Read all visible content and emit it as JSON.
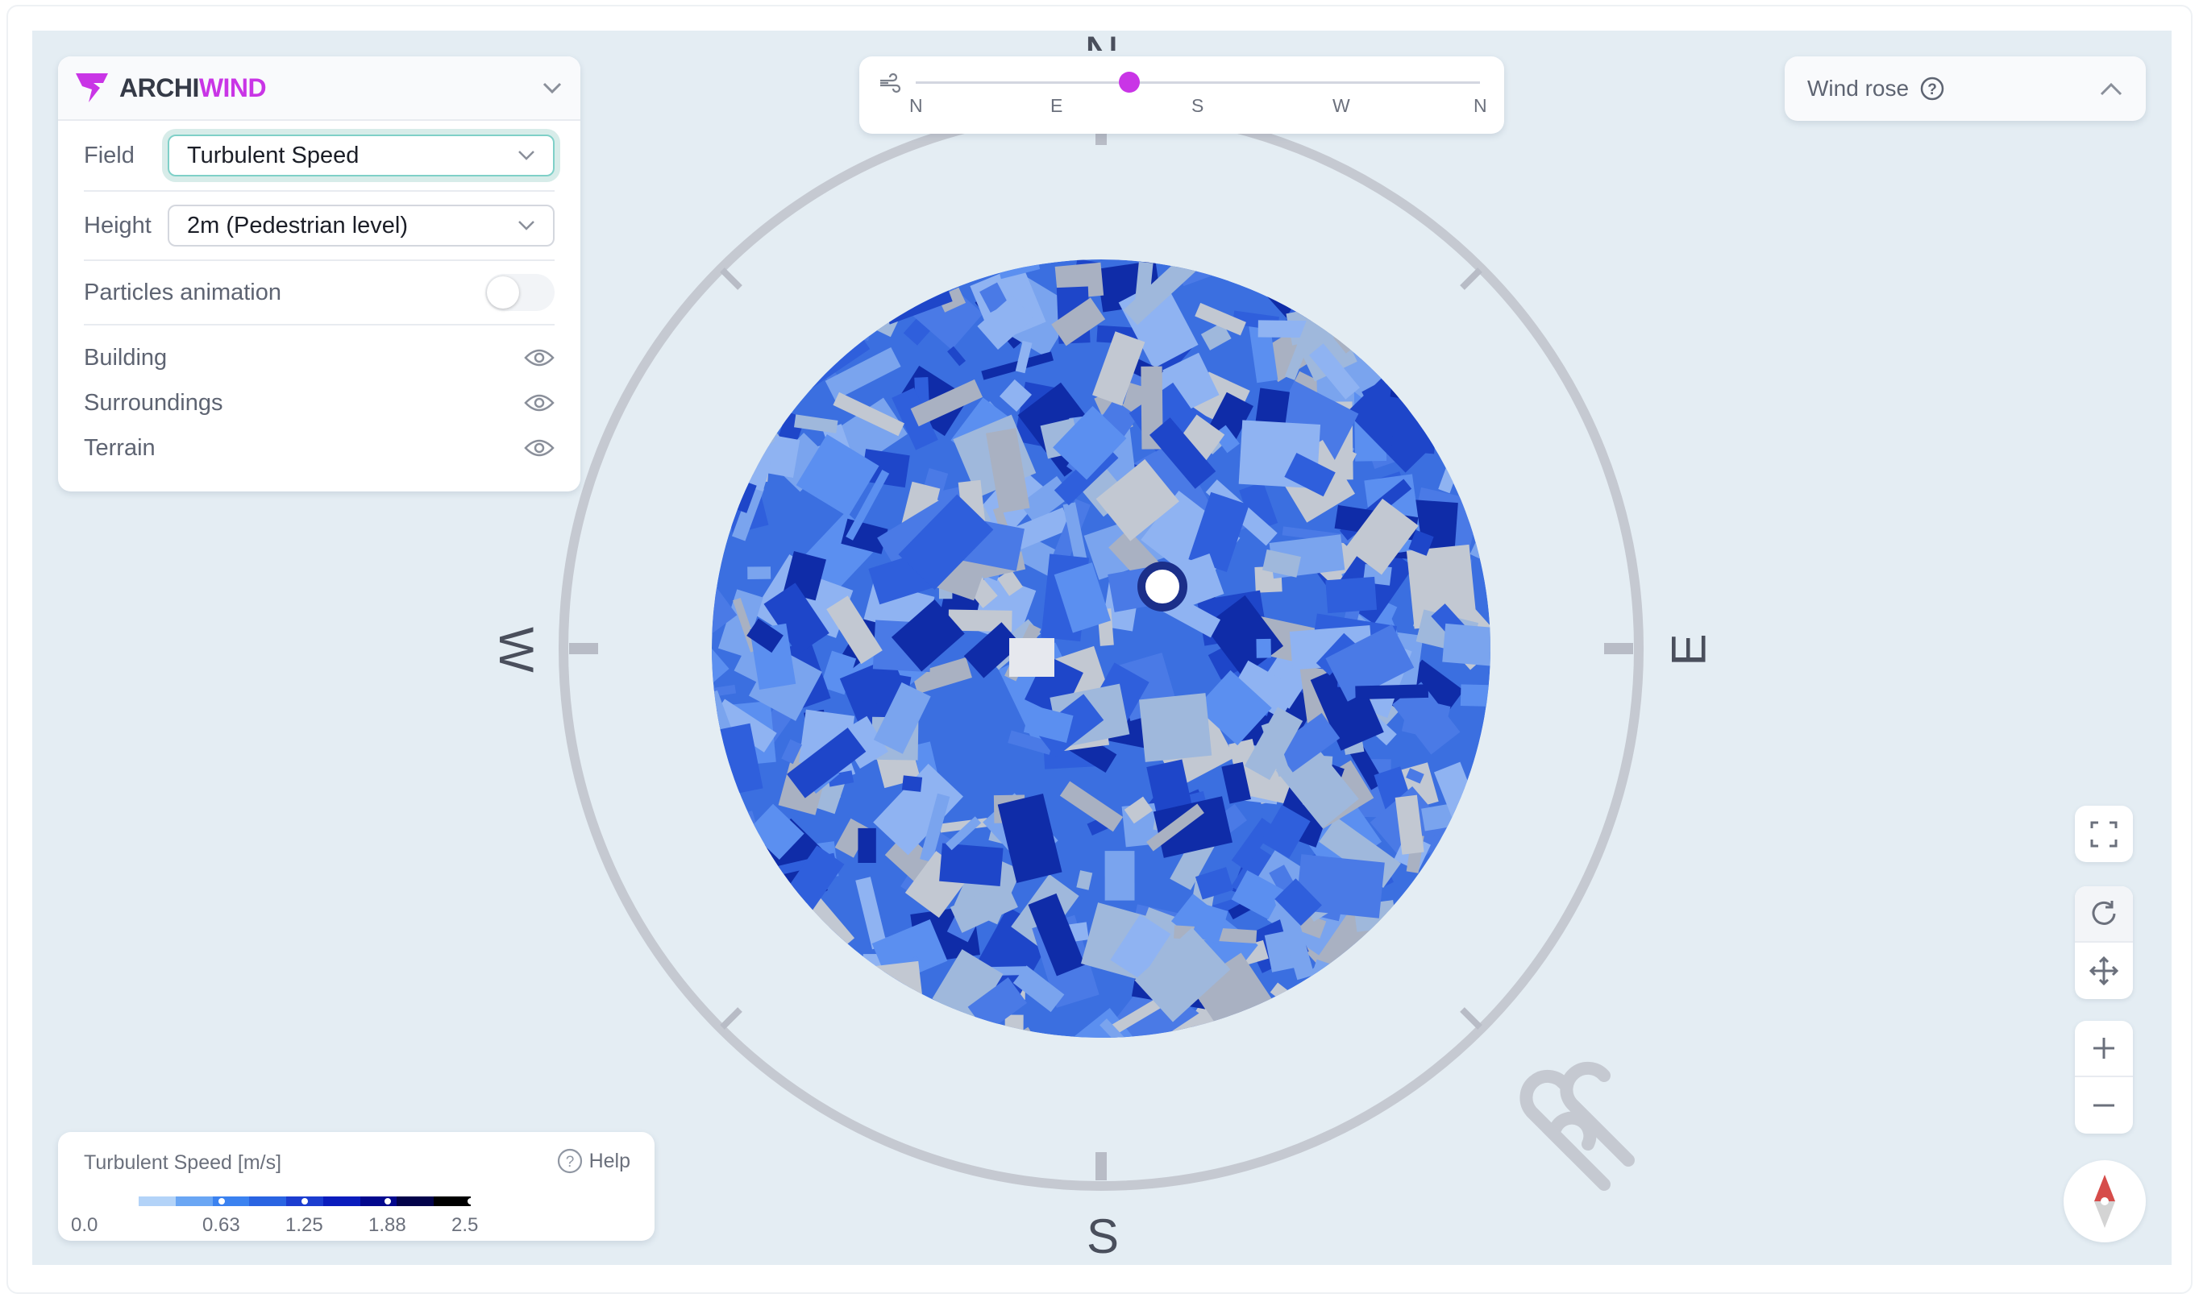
{
  "brand": {
    "part1": "ARCHI",
    "part2": "WIND",
    "accent": "#c935e6"
  },
  "panel": {
    "field_label": "Field",
    "field_value": "Turbulent Speed",
    "height_label": "Height",
    "height_value": "2m (Pedestrian level)",
    "particles_label": "Particles animation",
    "particles_on": false,
    "layers": [
      {
        "label": "Building",
        "visible": true
      },
      {
        "label": "Surroundings",
        "visible": true
      },
      {
        "label": "Terrain",
        "visible": true
      }
    ]
  },
  "direction_slider": {
    "labels": [
      "N",
      "E",
      "S",
      "W",
      "N"
    ],
    "value_fraction": 0.378,
    "thumb_color": "#c935e6"
  },
  "wind_rose": {
    "label": "Wind rose",
    "expanded": true
  },
  "compass": {
    "n": "N",
    "e": "E",
    "s": "S",
    "w": "W"
  },
  "legend": {
    "title": "Turbulent Speed [m/s]",
    "help": "Help",
    "ticks": [
      "0.0",
      "0.63",
      "1.25",
      "1.88",
      "2.5"
    ],
    "colors": [
      "#b3d3f8",
      "#6aa6f4",
      "#3b82f0",
      "#2a64e2",
      "#1c3dd0",
      "#0a1cbd",
      "#03088e",
      "#03034a",
      "#000000"
    ]
  },
  "controls": [
    "fullscreen-icon",
    "rotate-icon",
    "pan-icon",
    "zoom-in-icon",
    "zoom-out-icon",
    "north-arrow-icon"
  ]
}
